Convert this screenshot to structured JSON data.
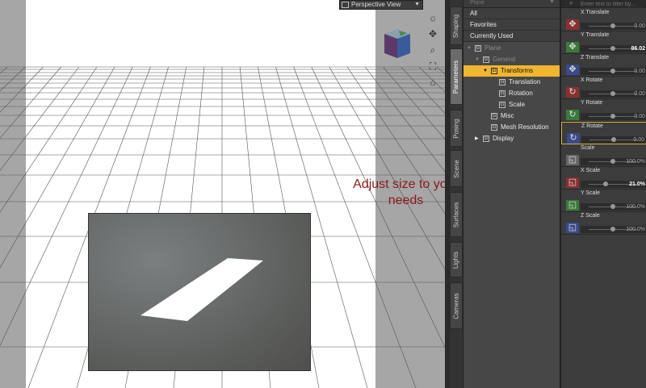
{
  "viewport": {
    "view_label": "Perspective View",
    "annotation": "Adjust size to your needs"
  },
  "tabs": [
    {
      "label": "Shaping",
      "active": false
    },
    {
      "label": "Parameters",
      "active": true
    },
    {
      "label": "Posing",
      "active": false
    },
    {
      "label": "Scene",
      "active": false
    },
    {
      "label": "Surfaces",
      "active": false
    },
    {
      "label": "Lights",
      "active": false
    },
    {
      "label": "Cameras",
      "active": false
    }
  ],
  "tree": {
    "header": "Plane",
    "categories": [
      "All",
      "Favorites",
      "Currently Used"
    ],
    "nodes": [
      {
        "label": "Plane",
        "level": 0,
        "dim": true,
        "selected": false,
        "expand": "open"
      },
      {
        "label": "General",
        "level": 1,
        "dim": true,
        "selected": false,
        "expand": "open"
      },
      {
        "label": "Transforms",
        "level": 2,
        "dim": false,
        "selected": true,
        "expand": "open"
      },
      {
        "label": "Translation",
        "level": 3,
        "dim": false,
        "selected": false,
        "expand": ""
      },
      {
        "label": "Rotation",
        "level": 3,
        "dim": false,
        "selected": false,
        "expand": ""
      },
      {
        "label": "Scale",
        "level": 3,
        "dim": false,
        "selected": false,
        "expand": ""
      },
      {
        "label": "Misc",
        "level": 2,
        "dim": false,
        "selected": false,
        "expand": ""
      },
      {
        "label": "Mesh Resolution",
        "level": 2,
        "dim": false,
        "selected": false,
        "expand": ""
      },
      {
        "label": "Display",
        "level": 1,
        "dim": false,
        "selected": false,
        "expand": "closed"
      }
    ]
  },
  "props": {
    "search_placeholder": "Enter text to filter by...",
    "items": [
      {
        "name": "X Translate",
        "value": "0.00",
        "knob": 0.5,
        "icon": "move",
        "color": "#8a3030"
      },
      {
        "name": "Y Translate",
        "value": "86.02",
        "knob": 0.5,
        "icon": "move",
        "color": "#3a7a3a",
        "strong": true
      },
      {
        "name": "Z Translate",
        "value": "0.00",
        "knob": 0.5,
        "icon": "move",
        "color": "#3a4a8a"
      },
      {
        "name": "X Rotate",
        "value": "0.00",
        "knob": 0.5,
        "icon": "rotate",
        "color": "#8a3030"
      },
      {
        "name": "Y Rotate",
        "value": "0.00",
        "knob": 0.5,
        "icon": "rotate",
        "color": "#3a7a3a"
      },
      {
        "name": "Z Rotate",
        "value": "0.00",
        "knob": 0.5,
        "icon": "rotate",
        "color": "#3a4a8a",
        "highlight": true
      },
      {
        "name": "Scale",
        "value": "100.0%",
        "knob": 0.5,
        "icon": "scale",
        "color": "#666"
      },
      {
        "name": "X Scale",
        "value": "21.0%",
        "knob": 0.35,
        "icon": "scale",
        "color": "#8a3030",
        "strong": true
      },
      {
        "name": "Y Scale",
        "value": "100.0%",
        "knob": 0.5,
        "icon": "scale",
        "color": "#3a7a3a"
      },
      {
        "name": "Z Scale",
        "value": "100.0%",
        "knob": 0.5,
        "icon": "scale",
        "color": "#3a4a8a"
      }
    ]
  }
}
